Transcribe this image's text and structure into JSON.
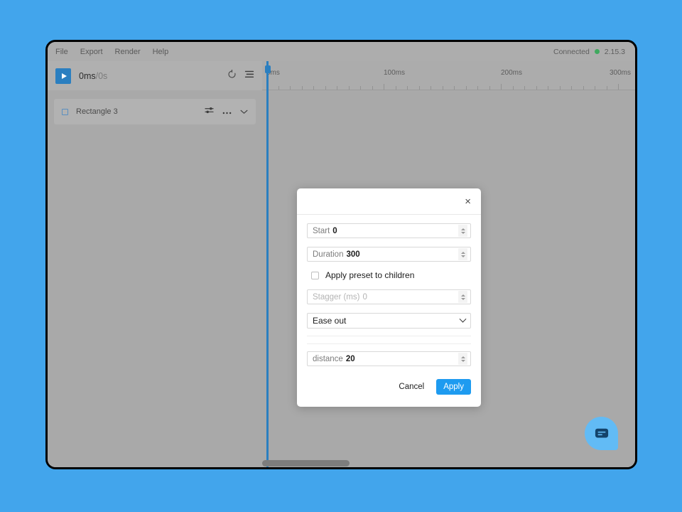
{
  "window": {
    "menu": {
      "items": [
        {
          "label": "File"
        },
        {
          "label": "Export"
        },
        {
          "label": "Render"
        },
        {
          "label": "Help"
        }
      ],
      "status_label": "Connected",
      "status_color": "#3fa95f",
      "version": "2.15.3"
    },
    "toolbar": {
      "play_icon": "play-icon",
      "current_time": "0ms",
      "total_time": "/0s",
      "loop_icon": "loop-icon",
      "layers_icon": "layers-icon"
    },
    "ruler": {
      "labels": [
        "0ms",
        "100ms",
        "200ms",
        "300ms"
      ],
      "tick_interval_ms": 10,
      "playhead_time_ms": 0
    },
    "layers": [
      {
        "name": "Rectangle 3",
        "swatch_icon": "rectangle-icon",
        "settings_icon": "sliders-icon",
        "more_icon": "ellipsis-icon",
        "expand_icon": "chevron-down-icon"
      }
    ],
    "chat": {
      "icon": "chat-bubble-icon",
      "color": "#62bbf5"
    }
  },
  "modal": {
    "close_label": "×",
    "fields": [
      {
        "label": "Start",
        "value": "0",
        "disabled": false
      },
      {
        "label": "Duration",
        "value": "300",
        "disabled": false
      }
    ],
    "checkbox": {
      "label": "Apply preset to children",
      "checked": false
    },
    "stagger": {
      "label": "Stagger (ms)",
      "value": "0",
      "disabled": true
    },
    "easing": {
      "value": "Ease out"
    },
    "distance": {
      "label": "distance",
      "value": "20",
      "disabled": false
    },
    "cancel_label": "Cancel",
    "apply_label": "Apply",
    "apply_color": "#1e9bf0"
  }
}
